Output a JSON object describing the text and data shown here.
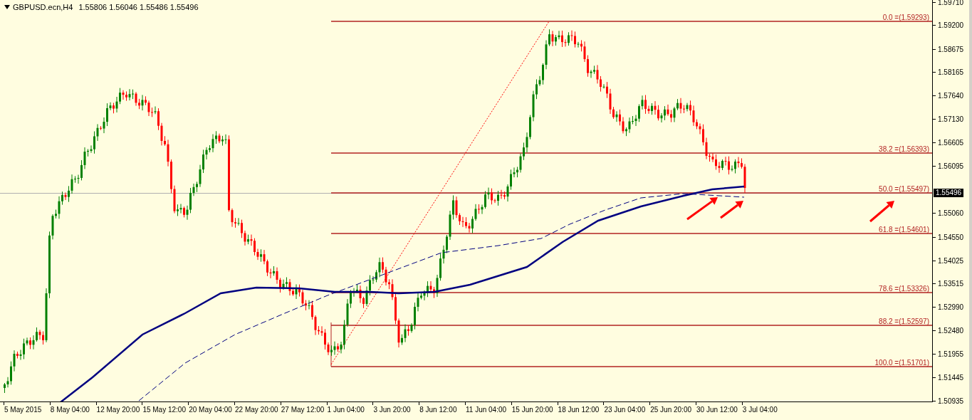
{
  "chart": {
    "header": {
      "symbol": "GBPUSD.ecn,H4",
      "ohlc": "1.55806 1.56046 1.55486 1.55496"
    },
    "fib_levels": [
      {
        "label": "0.0 =(1.59293)"
      },
      {
        "label": "38.2 =(1.56393)"
      },
      {
        "label": "50.0 =(1.55497)"
      },
      {
        "label": "61.8 =(1.54601)"
      },
      {
        "label": "78.6 =(1.53326)"
      },
      {
        "label": "88.2 =(1.52597)"
      },
      {
        "label": "100.0 =(1.51701)"
      }
    ],
    "price_axis": {
      "labels": [
        "1.59710",
        "1.59200",
        "1.58675",
        "1.58165",
        "1.57640",
        "1.57130",
        "1.56605",
        "1.56095",
        "1.55060",
        "1.54550",
        "1.54025",
        "1.53515",
        "1.52990",
        "1.52480",
        "1.51955",
        "1.51445",
        "1.50935"
      ]
    },
    "current_price": "1.55496",
    "time_axis": {
      "labels": [
        "5 May 2015",
        "8 May 04:00",
        "12 May 20:00",
        "15 May 12:00",
        "20 May 04:00",
        "22 May 20:00",
        "27 May 12:00",
        "1 Jun 04:00",
        "3 Jun 20:00",
        "8 Jun 12:00",
        "11 Jun 04:00",
        "15 Jun 20:00",
        "18 Jun 12:00",
        "23 Jun 04:00",
        "25 Jun 20:00",
        "30 Jun 12:00",
        "3 Jul 04:00"
      ]
    }
  }
}
